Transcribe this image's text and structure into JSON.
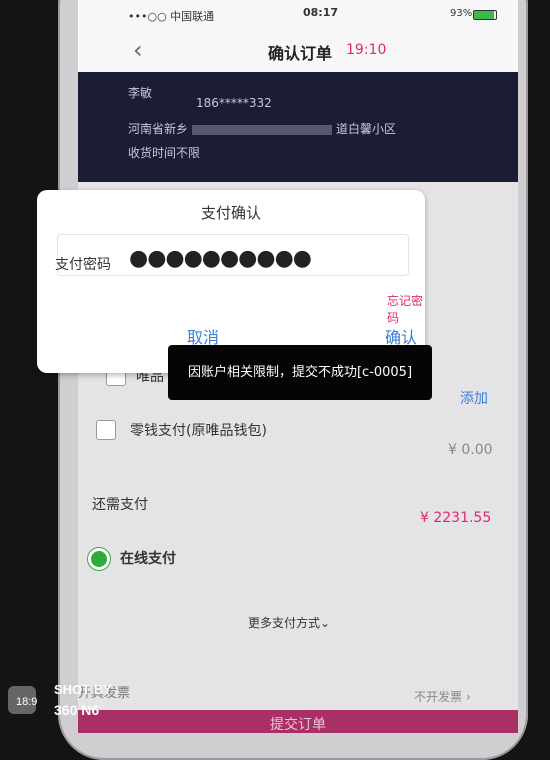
{
  "status_bar": {
    "carrier": "•••○○ 中国联通",
    "time": "08:17",
    "battery": "93%"
  },
  "nav": {
    "back_icon": "‹",
    "title": "确认订单",
    "timer": "19:10"
  },
  "address": {
    "name": "李敏",
    "phone": "186*****332",
    "street_prefix": "河南省新乡",
    "street_suffix": "道白馨小区",
    "delivery_time": "收货时间不限"
  },
  "payment_rows": {
    "vip_card_label": "唯品",
    "add_label": "添加",
    "wallet_label": "零钱支付(原唯品钱包)",
    "wallet_amount": "¥ 0.00",
    "still_pay_label": "还需支付",
    "still_pay_amount": "¥ 2231.55",
    "online_pay_label": "在线支付",
    "more_methods": "更多支付方式⌄",
    "invoice_label": "开具发票",
    "invoice_value": "不开发票 ›",
    "submit_label": "提交订单"
  },
  "dialog": {
    "title": "支付确认",
    "password_label": "支付密码",
    "password_value": "●●●●●●●●●●",
    "forgot_label": "忘记密码",
    "cancel_label": "取消",
    "confirm_label": "确认"
  },
  "toast": {
    "message": "因账户相关限制，提交不成功[c-0005]"
  },
  "watermark": {
    "line1": "SHOT BY",
    "line2": "360 N6",
    "small": "18:9"
  },
  "colors": {
    "accent": "#e0286a",
    "link_blue": "#3a7fd5",
    "radio_green": "#2eab3c"
  }
}
